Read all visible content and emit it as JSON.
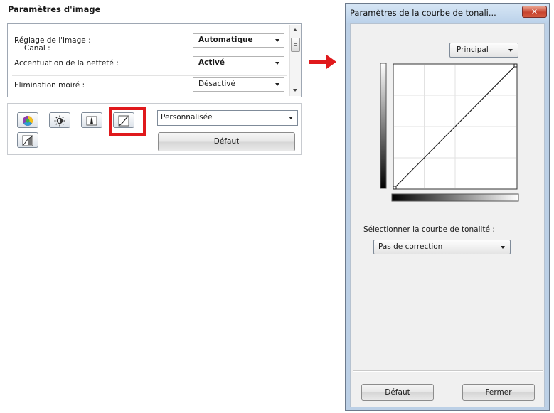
{
  "left_panel": {
    "title": "Paramètres d'image",
    "settings": [
      {
        "label": "Réglage de l'image :",
        "value": "Automatique",
        "bold": true
      },
      {
        "label": "Accentuation de la netteté :",
        "value": "Activé",
        "bold": true
      },
      {
        "label": "Elimination moiré :",
        "value": "Désactivé",
        "bold": false
      }
    ],
    "tools": {
      "icons": [
        "color-wheel-icon",
        "brightness-contrast-icon",
        "histogram-icon",
        "tone-curve-icon",
        "threshold-icon"
      ],
      "highlighted": "tone-curve-icon",
      "highlight_color": "#e0191c"
    },
    "preset_select": {
      "value": "Personnalisée"
    },
    "default_button": "Défaut"
  },
  "arrow_color": "#e0191c",
  "dialog": {
    "title": "Paramètres de la courbe de tonali...",
    "close_glyph": "✕",
    "channel_label": "Canal :",
    "channel_value": "Principal",
    "tone_curve_label": "Sélectionner la courbe de tonalité :",
    "tone_curve_value": "Pas de correction",
    "default_button": "Défaut",
    "close_button": "Fermer"
  }
}
